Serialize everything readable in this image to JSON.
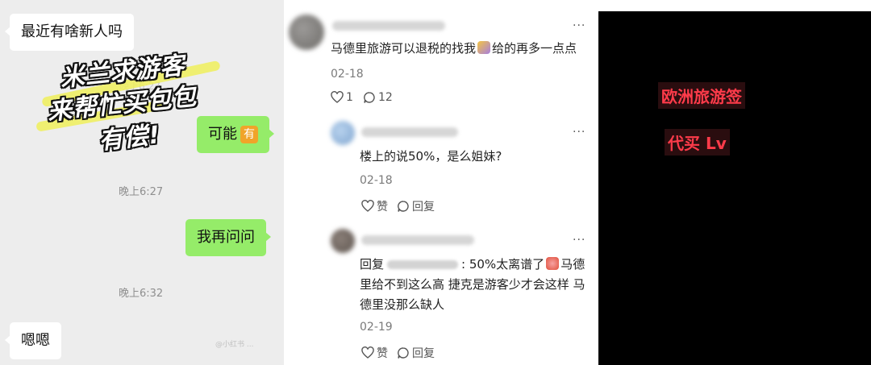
{
  "chat": {
    "messages": [
      {
        "text": "最近有啥新人吗"
      },
      {
        "text": "可能",
        "badge": "有"
      },
      {
        "text": "我再问问"
      },
      {
        "text": "嗯嗯"
      }
    ],
    "timestamps": [
      "晚上6:27",
      "晚上6:32"
    ],
    "ghost_timestamp": "晚上6:27",
    "overlay_lines": [
      "米兰求游客",
      "来帮忙买包包",
      "有偿!"
    ],
    "watermark": "@小红书 ..."
  },
  "comments": {
    "more_label": "···",
    "items": [
      {
        "text": "马德里旅游可以退税的找我",
        "text_after": "给的再多一点点",
        "date": "02-18",
        "likes": "1",
        "replies": "12"
      },
      {
        "text": "楼上的说50%，是么姐妹?",
        "date": "02-18",
        "like_label": "赞",
        "reply_label": "回复"
      },
      {
        "reply_prefix": "回复",
        "text_part1": ": 50%太离谱了",
        "text_part2": "马德",
        "line2": "里给不到这么高 捷克是游客少才会这样 马",
        "line3": "德里没那么缺人",
        "date": "02-19",
        "like_label": "赞",
        "reply_label": "回复"
      }
    ]
  },
  "panel": {
    "tags": [
      "欧洲旅游签",
      "代买 Lv"
    ],
    "tag_color": "#ff3b4a"
  }
}
